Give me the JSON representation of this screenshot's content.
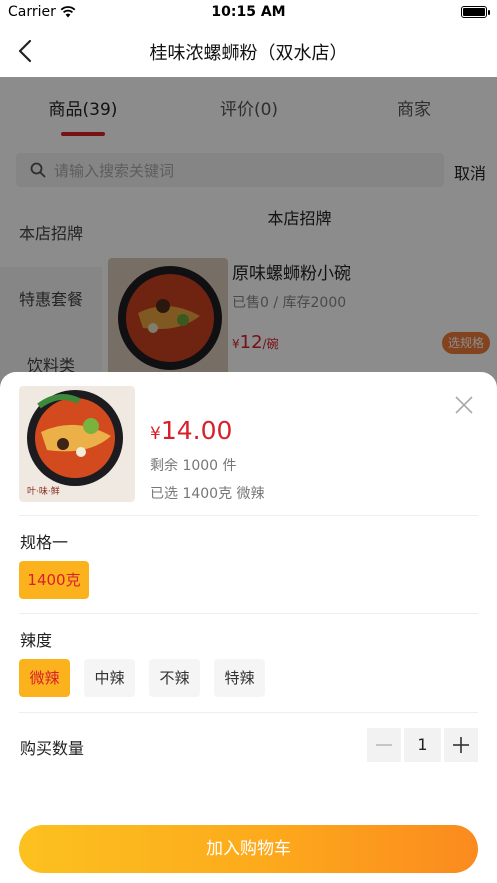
{
  "status_bar": {
    "carrier": "Carrier",
    "time": "10:15 AM"
  },
  "nav": {
    "title": "桂味浓螺蛳粉（双水店）"
  },
  "tabs": [
    {
      "label": "商品(39)",
      "active": true
    },
    {
      "label": "评价(0)",
      "active": false
    },
    {
      "label": "商家",
      "active": false
    }
  ],
  "search": {
    "placeholder": "请输入搜索关键词",
    "cancel_label": "取消"
  },
  "categories": [
    {
      "label": "本店招牌",
      "active": true
    },
    {
      "label": "特惠套餐",
      "active": false
    },
    {
      "label": "饮料类",
      "active": false
    }
  ],
  "category_header": "本店招牌",
  "product": {
    "name": "原味螺蛳粉小碗",
    "sold_stock": "已售0 / 库存2000",
    "currency": "¥",
    "price": "12",
    "unit": "/碗",
    "spec_button": "选规格"
  },
  "sheet": {
    "currency": "¥",
    "price": "14.00",
    "remaining": "剩余 1000 件",
    "selected": "已选 1400克 微辣",
    "spec_title": "规格一",
    "spec_options": [
      {
        "label": "1400克",
        "selected": true
      }
    ],
    "spice_title": "辣度",
    "spice_options": [
      {
        "label": "微辣",
        "selected": true
      },
      {
        "label": "中辣",
        "selected": false
      },
      {
        "label": "不辣",
        "selected": false
      },
      {
        "label": "特辣",
        "selected": false
      }
    ],
    "quantity_label": "购买数量",
    "quantity": "1",
    "add_to_cart": "加入购物车"
  },
  "colors": {
    "accent_red": "#d8202b",
    "selected_option": "#fcb21d",
    "button_gradient_start": "#fcc11f",
    "button_gradient_end": "#fb8a1e"
  }
}
